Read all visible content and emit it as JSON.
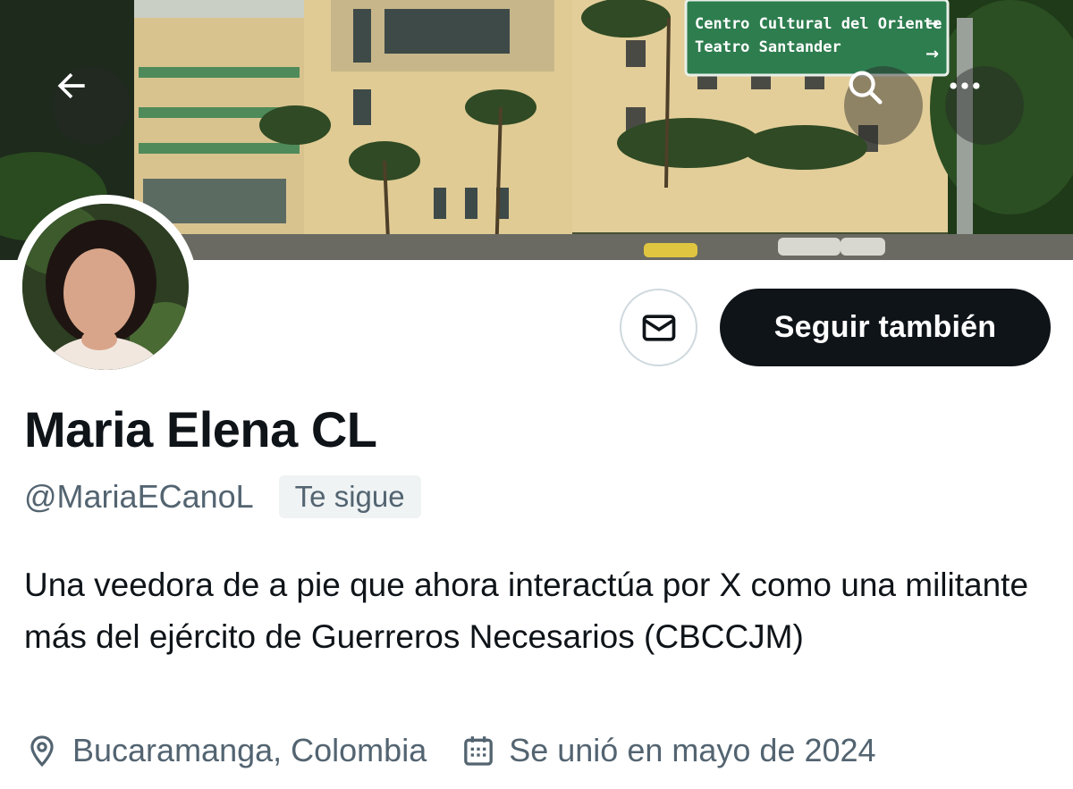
{
  "banner": {
    "sign_line1": "Centro Cultural del Oriente",
    "sign_line2": "Teatro Santander",
    "sign_arrow": "→"
  },
  "toolbar": {
    "back_icon": "arrow-left-icon",
    "search_icon": "search-icon",
    "more_icon": "more-horizontal-icon"
  },
  "actions": {
    "message_icon": "mail-icon",
    "follow_label": "Seguir también"
  },
  "profile": {
    "display_name": "Maria Elena CL",
    "handle": "@MariaECanoL",
    "follows_you_badge": "Te sigue",
    "bio": "Una veedora de a pie que ahora interactúa por X como una militante más del ejército de Guerreros Necesarios (CBCCJM)",
    "location": "Bucaramanga, Colombia",
    "joined": "Se unió en mayo de 2024"
  },
  "colors": {
    "primary_text": "#0f1419",
    "secondary_text": "#536471",
    "button_bg": "#0f1419",
    "badge_bg": "#eff3f4",
    "border": "#cfd9de",
    "sign_green": "#2e7d4f"
  }
}
